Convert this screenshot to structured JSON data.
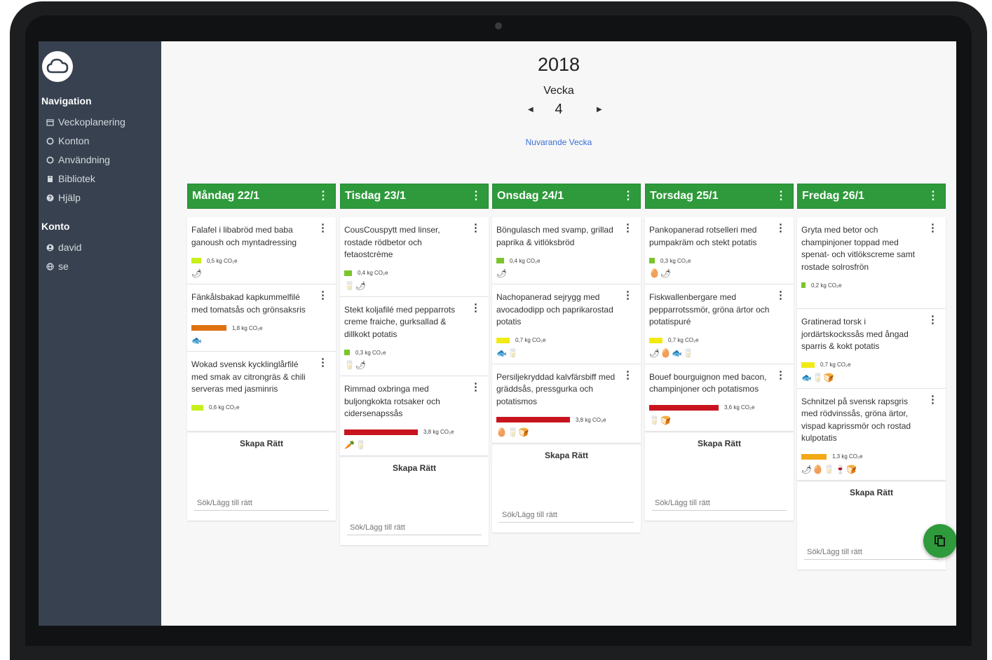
{
  "sidebar": {
    "navigation_heading": "Navigation",
    "nav_items": [
      {
        "label": "Veckoplanering",
        "icon": "calendar-icon"
      },
      {
        "label": "Konton",
        "icon": "circle-icon"
      },
      {
        "label": "Användning",
        "icon": "circle-icon"
      },
      {
        "label": "Bibliotek",
        "icon": "book-icon"
      },
      {
        "label": "Hjälp",
        "icon": "help-icon"
      }
    ],
    "account_heading": "Konto",
    "account_items": [
      {
        "label": "david",
        "icon": "user-icon"
      },
      {
        "label": "se",
        "icon": "globe-icon"
      }
    ]
  },
  "header": {
    "year": "2018",
    "week_label": "Vecka",
    "week_number": "4",
    "current_week_link": "Nuvarande Vecka"
  },
  "days": [
    {
      "title": "Måndag 22/1",
      "dishes": [
        {
          "name": "Falafel i libabröd med baba ganoush och myntadressing",
          "co2": "0,5 kg CO₂e",
          "icons": "🌶"
        },
        {
          "name": "Fänkålsbakad kapkummelfilé med tomatsås och grönsaksris",
          "co2": "1,8 kg CO₂e",
          "icons": "🐟"
        },
        {
          "name": "Wokad svensk kycklinglårfilé med smak av citrongräs & chili serveras med jasminris",
          "co2": "0,6 kg CO₂e",
          "icons": ""
        }
      ],
      "create_label": "Skapa Rätt",
      "search_placeholder": "Sök/Lägg till rätt"
    },
    {
      "title": "Tisdag 23/1",
      "dishes": [
        {
          "name": "CousCouspytt med linser, rostade rödbetor och fetaostcrème",
          "co2": "0,4 kg CO₂e",
          "icons": "🥛🌶"
        },
        {
          "name": "Stekt koljafilé med pepparrots creme fraiche, gurksallad & dillkokt potatis",
          "co2": "0,3 kg CO₂e",
          "icons": "🥛🌶"
        },
        {
          "name": "Rimmad oxbringa med buljongkokta rotsaker och cidersenapssås",
          "co2": "3,8 kg CO₂e",
          "icons": "🥕🥛"
        }
      ],
      "create_label": "Skapa Rätt",
      "search_placeholder": "Sök/Lägg till rätt"
    },
    {
      "title": "Onsdag 24/1",
      "dishes": [
        {
          "name": "Böngulasch med svamp, grillad paprika & vitlöksbröd",
          "co2": "0,4 kg CO₂e",
          "icons": "🌶"
        },
        {
          "name": "Nachopanerad sejrygg med avocadodipp och paprikarostad potatis",
          "co2": "0,7 kg CO₂e",
          "icons": "🐟🥛"
        },
        {
          "name": "Persiljekryddad kalvfärsbiff med gräddsås, pressgurka och potatismos",
          "co2": "3,8 kg CO₂e",
          "icons": "🥚🥛🍞"
        }
      ],
      "create_label": "Skapa Rätt",
      "search_placeholder": "Sök/Lägg till rätt"
    },
    {
      "title": "Torsdag 25/1",
      "dishes": [
        {
          "name": "Pankopanerad rotselleri med pumpakräm och stekt potatis",
          "co2": "0,3 kg CO₂e",
          "icons": "🥚🌶"
        },
        {
          "name": "Fiskwallenbergare med pepparrotssmör, gröna ärtor och potatispuré",
          "co2": "0,7 kg CO₂e",
          "icons": "🌶🥚🐟🥛"
        },
        {
          "name": "Bouef bourguignon med bacon, champinjoner och potatismos",
          "co2": "3,6 kg CO₂e",
          "icons": "🥛🍞"
        }
      ],
      "create_label": "Skapa Rätt",
      "search_placeholder": "Sök/Lägg till rätt"
    },
    {
      "title": "Fredag 26/1",
      "dishes": [
        {
          "name": "Gryta med betor och champinjoner toppad med spenat- och vitlökscreme samt rostade solrosfrön",
          "co2": "0,2 kg CO₂e",
          "icons": ""
        },
        {
          "name": "Gratinerad torsk i jordärtskockssås med ångad sparris & kokt potatis",
          "co2": "0,7 kg CO₂e",
          "icons": "🐟🥛🍞"
        },
        {
          "name": "Schnitzel på svensk rapsgris med rödvinssås, gröna ärtor, vispad kaprissmör och rostad kulpotatis",
          "co2": "1,3 kg CO₂e",
          "icons": "🌶🥚🥛🍷🍞"
        }
      ],
      "create_label": "Skapa Rätt",
      "search_placeholder": "Sök/Lägg till rätt"
    }
  ],
  "co2_levels": {
    "mon": [
      0.5,
      1.8,
      0.6
    ],
    "tue": [
      0.4,
      0.3,
      3.8
    ],
    "wed": [
      0.4,
      0.7,
      3.8
    ],
    "thu": [
      0.3,
      0.7,
      3.6
    ],
    "fri": [
      0.2,
      0.7,
      1.3
    ]
  },
  "colors": {
    "header_green": "#2e9a3b",
    "sidebar_bg": "#37414f",
    "link_blue": "#3b6fd6"
  }
}
